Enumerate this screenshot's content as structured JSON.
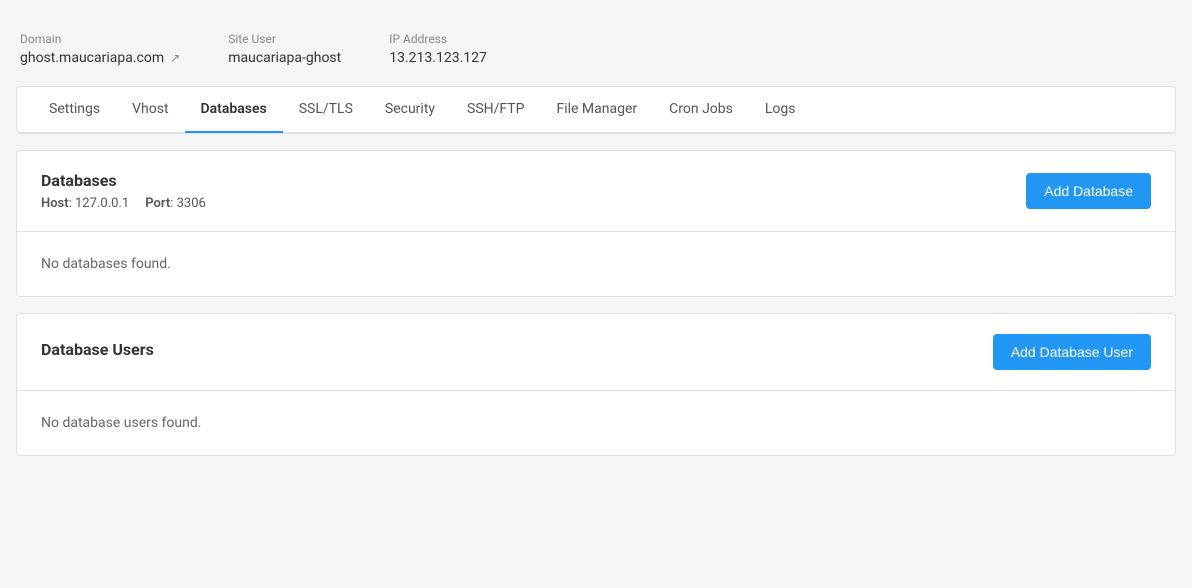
{
  "server_info": {
    "domain_label": "Domain",
    "domain_value": "ghost.maucariapa.com",
    "site_user_label": "Site User",
    "site_user_value": "maucariapa-ghost",
    "ip_address_label": "IP Address",
    "ip_address_value": "13.213.123.127"
  },
  "tabs": [
    {
      "id": "settings",
      "label": "Settings",
      "active": false
    },
    {
      "id": "vhost",
      "label": "Vhost",
      "active": false
    },
    {
      "id": "databases",
      "label": "Databases",
      "active": true
    },
    {
      "id": "ssl-tls",
      "label": "SSL/TLS",
      "active": false
    },
    {
      "id": "security",
      "label": "Security",
      "active": false
    },
    {
      "id": "ssh-ftp",
      "label": "SSH/FTP",
      "active": false
    },
    {
      "id": "file-manager",
      "label": "File Manager",
      "active": false
    },
    {
      "id": "cron-jobs",
      "label": "Cron Jobs",
      "active": false
    },
    {
      "id": "logs",
      "label": "Logs",
      "active": false
    }
  ],
  "databases_section": {
    "title": "Databases",
    "host_label": "Host",
    "host_value": "127.0.0.1",
    "port_label": "Port",
    "port_value": "3306",
    "add_button_label": "Add Database",
    "empty_message": "No databases found."
  },
  "database_users_section": {
    "title": "Database Users",
    "add_button_label": "Add Database User",
    "empty_message": "No database users found."
  }
}
